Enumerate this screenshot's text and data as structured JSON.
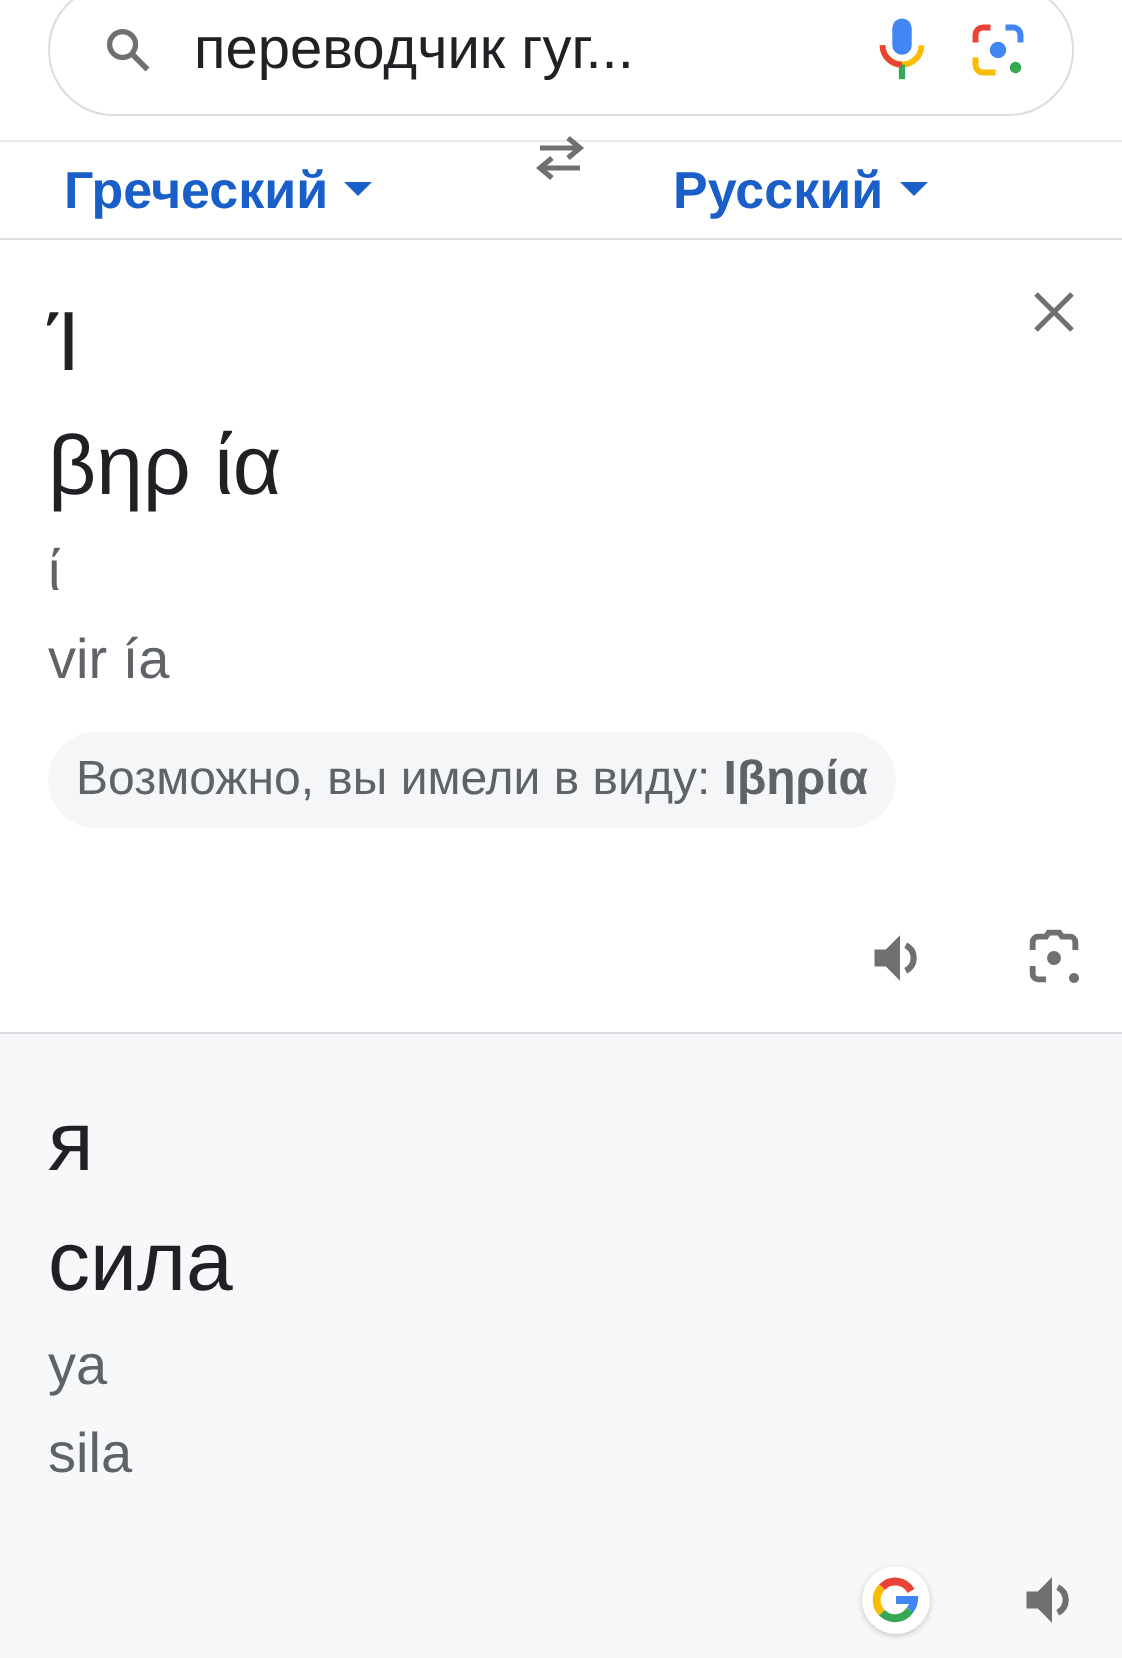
{
  "search": {
    "value": "переводчик гуг..."
  },
  "languages": {
    "source": "Греческий",
    "target": "Русский"
  },
  "source": {
    "lines": [
      "Ί",
      "βηρ ία"
    ],
    "transliteration": [
      "ί",
      "vir ía"
    ],
    "suggestion": "Возможно, вы имели в виду: **Ιβηρία**"
  },
  "target": {
    "lines": [
      "я",
      "сила"
    ],
    "transliteration": [
      "ya",
      "sila"
    ]
  }
}
